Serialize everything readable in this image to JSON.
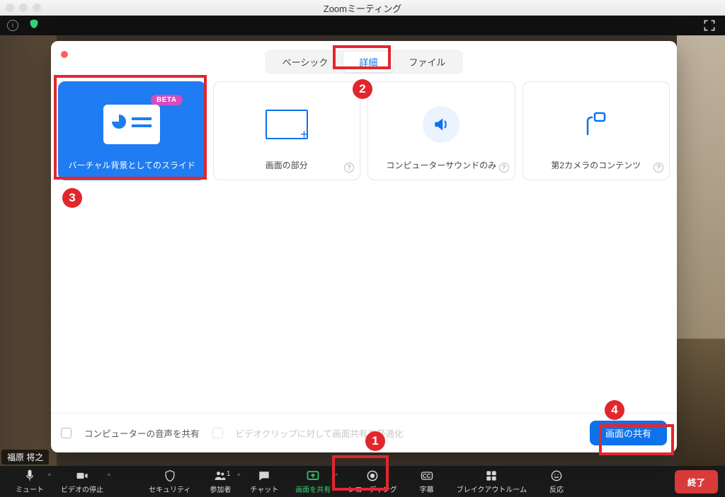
{
  "window": {
    "title": "Zoomミーティング"
  },
  "name_tag": "福原 将之",
  "dialog": {
    "tabs": {
      "basic": "ベーシック",
      "advanced": "詳細",
      "file": "ファイル"
    },
    "cards": {
      "slides": {
        "label": "バーチャル背景としてのスライド",
        "badge": "BETA"
      },
      "portion": {
        "label": "画面の部分"
      },
      "sound": {
        "label": "コンピューターサウンドのみ"
      },
      "cam2": {
        "label": "第2カメラのコンテンツ"
      }
    },
    "footer": {
      "share_audio": "コンピューターの音声を共有",
      "optimize_clip": "ビデオクリップに対して画面共有を最適化",
      "share_button": "画面の共有"
    }
  },
  "toolbar": {
    "mute": "ミュート",
    "stop_video": "ビデオの停止",
    "security": "セキュリティ",
    "participants": "参加者",
    "participants_count": "1",
    "chat": "チャット",
    "share_screen": "画面を共有",
    "recording": "レコーディング",
    "cc": "字幕",
    "breakout": "ブレイクアウトルーム",
    "reactions": "反応",
    "end": "終了"
  },
  "annotations": {
    "n1": "1",
    "n2": "2",
    "n3": "3",
    "n4": "4"
  }
}
